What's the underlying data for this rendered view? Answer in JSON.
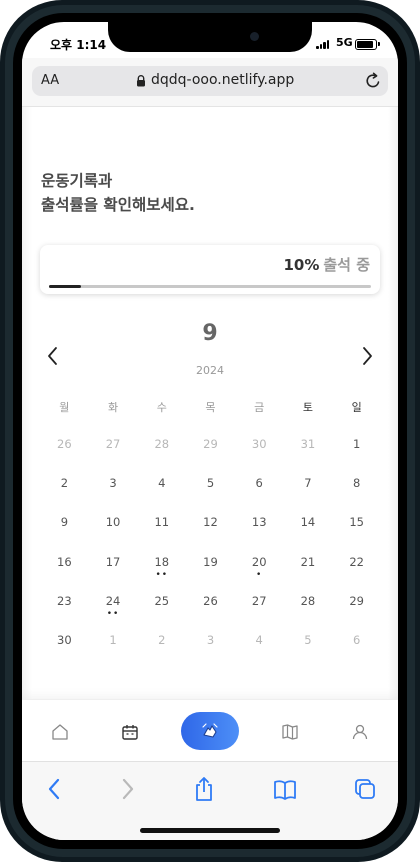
{
  "status": {
    "time": "오후 1:14",
    "network": "5G"
  },
  "browser": {
    "text_size_label": "AA",
    "url": "dqdq-ooo.netlify.app"
  },
  "headline": {
    "line1": "운동기록과",
    "line2": "출석률을 확인해보세요."
  },
  "attendance": {
    "percent_text": "10%",
    "label": "출석 중",
    "progress": 0.1,
    "accent": "#222222"
  },
  "calendar": {
    "month": "9",
    "year": "2024",
    "weekdays": [
      "월",
      "화",
      "수",
      "목",
      "금",
      "토",
      "일"
    ],
    "weeks": [
      [
        {
          "d": "26",
          "m": true
        },
        {
          "d": "27",
          "m": true
        },
        {
          "d": "28",
          "m": true
        },
        {
          "d": "29",
          "m": true
        },
        {
          "d": "30",
          "m": true
        },
        {
          "d": "31",
          "m": true
        },
        {
          "d": "1"
        }
      ],
      [
        {
          "d": "2"
        },
        {
          "d": "3"
        },
        {
          "d": "4"
        },
        {
          "d": "5"
        },
        {
          "d": "6"
        },
        {
          "d": "7"
        },
        {
          "d": "8"
        }
      ],
      [
        {
          "d": "9"
        },
        {
          "d": "10"
        },
        {
          "d": "11"
        },
        {
          "d": "12"
        },
        {
          "d": "13"
        },
        {
          "d": "14"
        },
        {
          "d": "15"
        }
      ],
      [
        {
          "d": "16"
        },
        {
          "d": "17"
        },
        {
          "d": "18",
          "dots": "••"
        },
        {
          "d": "19"
        },
        {
          "d": "20",
          "dots": "•"
        },
        {
          "d": "21"
        },
        {
          "d": "22"
        }
      ],
      [
        {
          "d": "23"
        },
        {
          "d": "24",
          "dots": "••"
        },
        {
          "d": "25"
        },
        {
          "d": "26"
        },
        {
          "d": "27"
        },
        {
          "d": "28"
        },
        {
          "d": "29"
        }
      ],
      [
        {
          "d": "30"
        },
        {
          "d": "1",
          "m": true
        },
        {
          "d": "2",
          "m": true
        },
        {
          "d": "3",
          "m": true
        },
        {
          "d": "4",
          "m": true
        },
        {
          "d": "5",
          "m": true
        },
        {
          "d": "6",
          "m": true
        }
      ]
    ]
  },
  "tabbar": {
    "items": [
      "home-icon",
      "calendar-icon",
      "workout-hands-icon",
      "map-icon",
      "profile-icon"
    ],
    "active_color": "#3a78ef"
  },
  "browser_toolbar": {
    "items": [
      "back-icon",
      "forward-icon",
      "share-icon",
      "bookmarks-icon",
      "tabs-icon"
    ],
    "accent": "#2f7bf5"
  }
}
